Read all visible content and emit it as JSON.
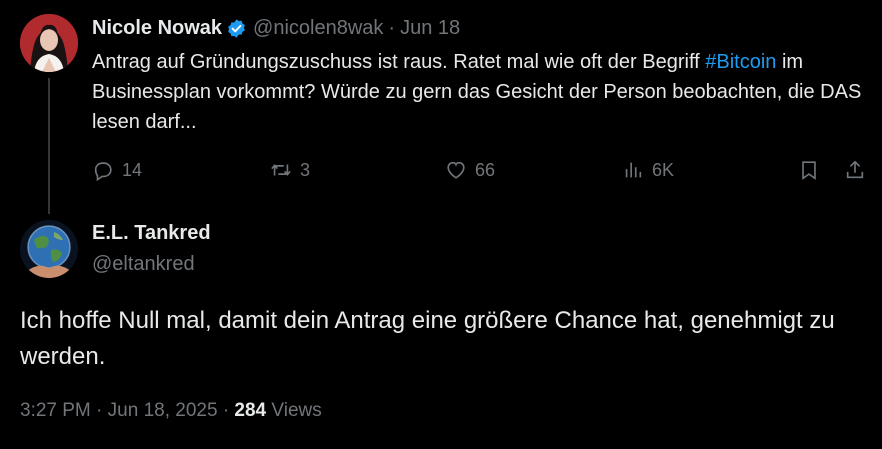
{
  "tweet": {
    "author_name": "Nicole Nowak",
    "author_handle": "@nicolen8wak",
    "separator": "·",
    "date": "Jun 18",
    "text_before": "Antrag auf Gründungszuschuss ist raus. Ratet mal wie oft der Begriff ",
    "hashtag": "#Bitcoin",
    "text_after": " im Businessplan vorkommt? Würde zu gern das Gesicht der Person beobachten, die DAS lesen darf...",
    "actions": {
      "replies": "14",
      "reposts": "3",
      "likes": "66",
      "views": "6K"
    }
  },
  "reply": {
    "author_name": "E.L. Tankred",
    "author_handle": "@eltankred",
    "text": "Ich hoffe Null mal, damit dein Antrag eine größere Chance hat, genehmigt zu werden.",
    "time": "3:27 PM",
    "separator": "·",
    "date": "Jun 18, 2025",
    "views_count": "284",
    "views_label": "Views"
  },
  "colors": {
    "background": "#000000",
    "text": "#e7e9ea",
    "muted": "#71767b",
    "link": "#1d9bf0",
    "verified": "#1d9bf0",
    "thread_line": "#333639"
  },
  "icons": [
    "verified-badge-icon",
    "reply-icon",
    "repost-icon",
    "like-icon",
    "views-icon",
    "bookmark-icon",
    "share-icon"
  ]
}
